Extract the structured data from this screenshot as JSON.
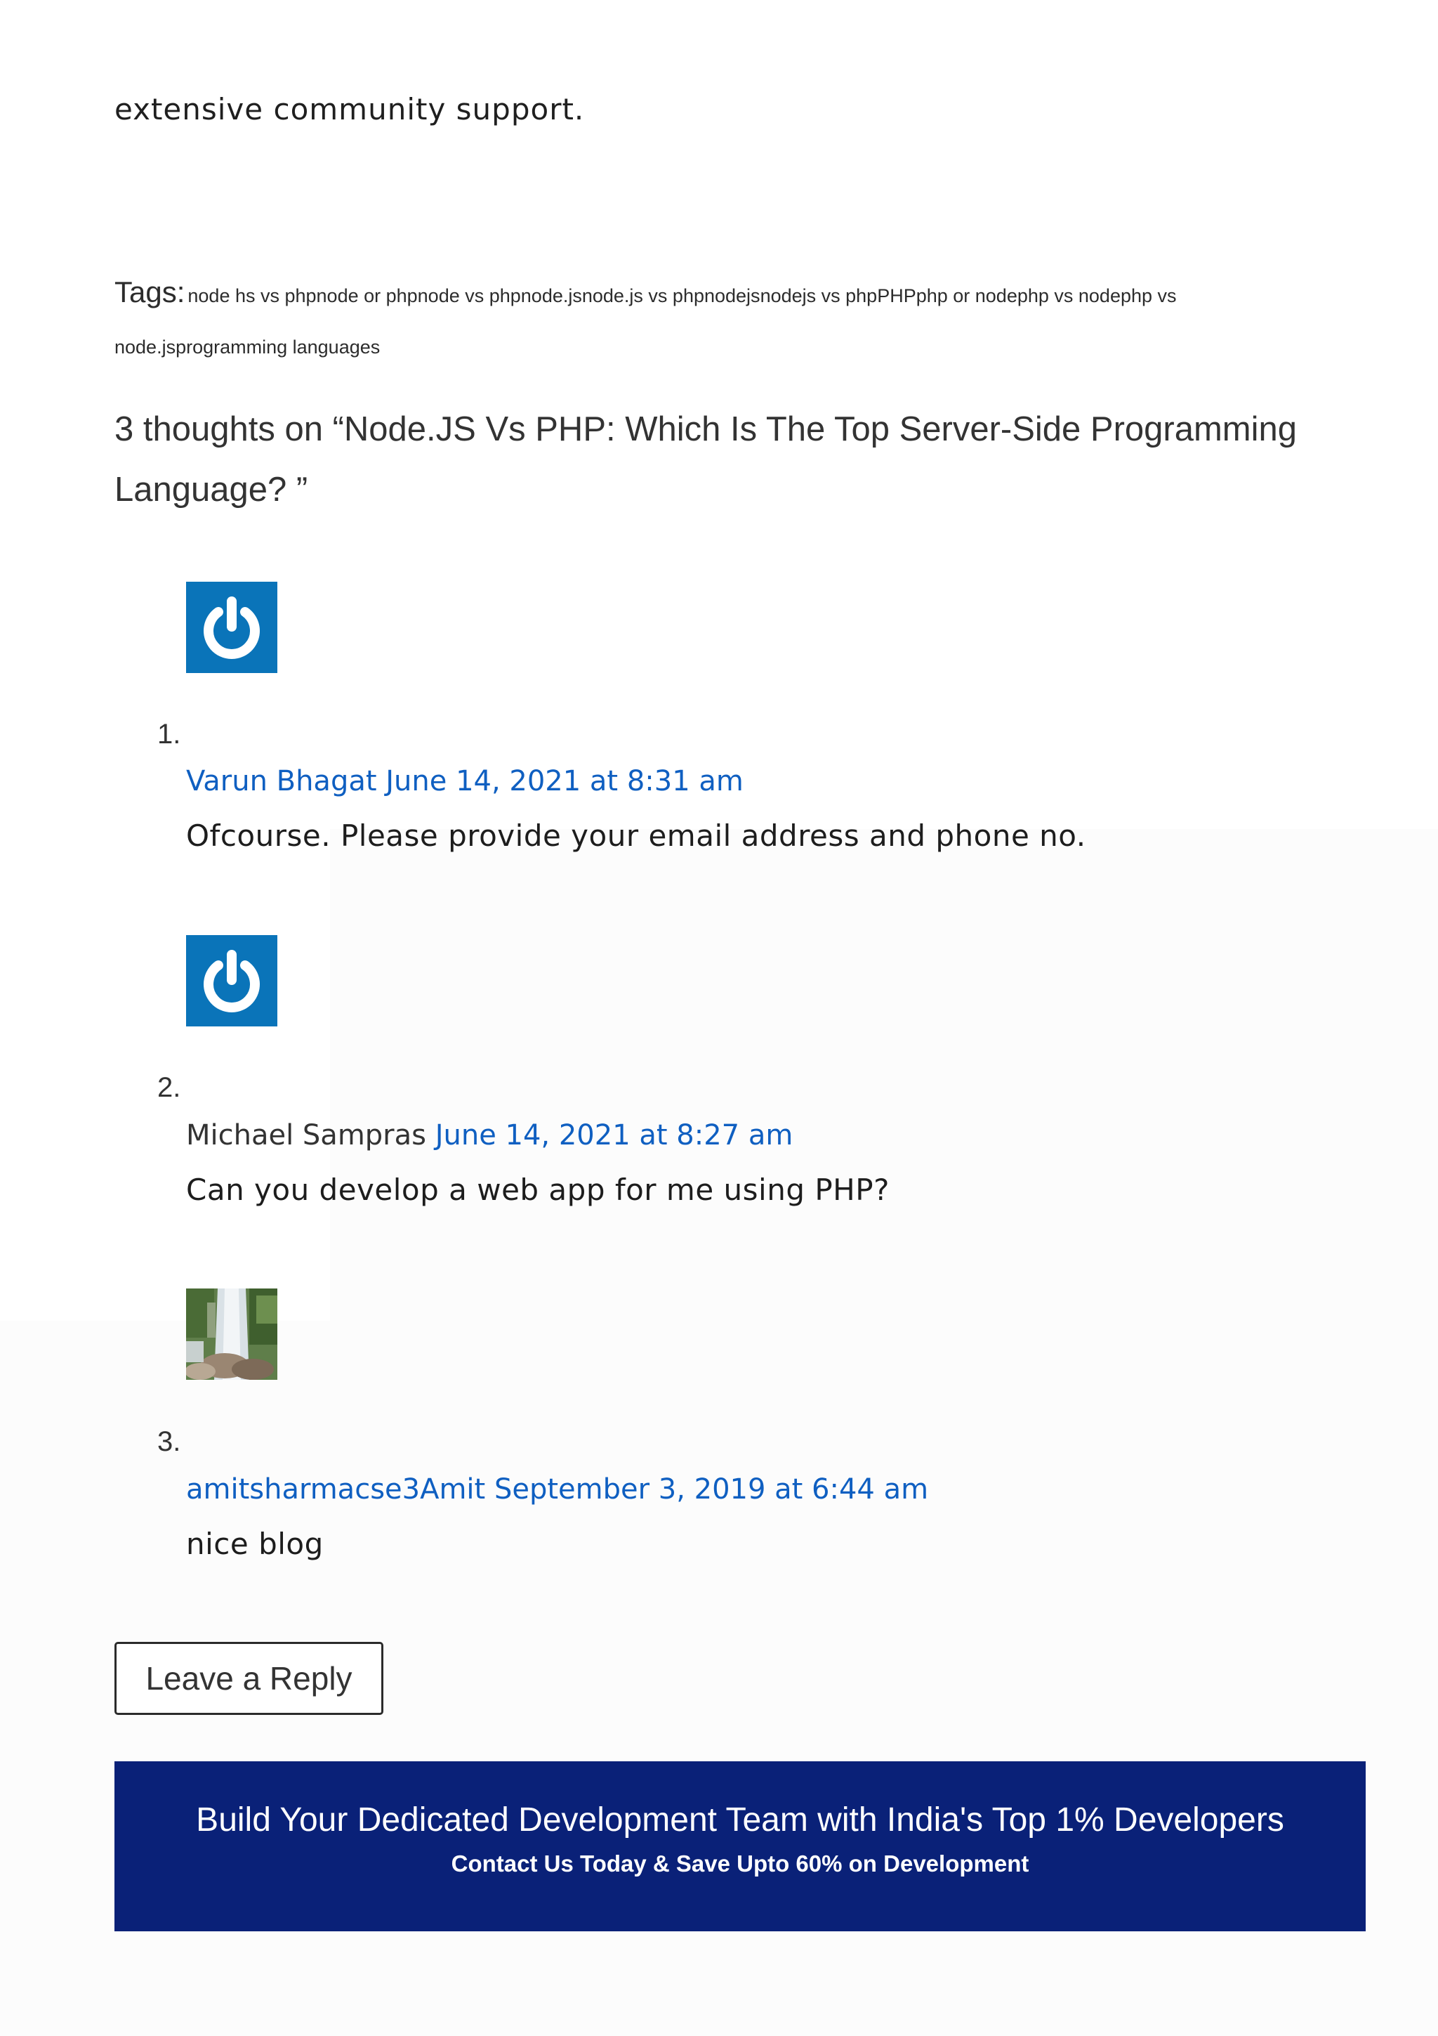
{
  "intro": {
    "text": "extensive community support."
  },
  "tags": {
    "label": "Tags:",
    "items": [
      "node hs vs php",
      "node or php",
      "node vs php",
      "node.js",
      "node.js vs php",
      "nodejs",
      "nodejs vs php",
      "PHP",
      "php or node",
      "php vs node",
      "php vs node.js",
      "programming languages"
    ]
  },
  "comments_section": {
    "title": "3 thoughts on “Node.JS Vs PHP: Which Is The Top Server-Side Programming Language? ”",
    "comments": [
      {
        "number": "1.",
        "author": "Varun Bhagat",
        "date": "June 14, 2021 at 8:31 am",
        "body": "Ofcourse. Please provide your email address and phone no.",
        "avatar_icon": "power-icon"
      },
      {
        "number": "2.",
        "author": "Michael Sampras",
        "date": "June 14, 2021 at 8:27 am",
        "body": "Can you develop a web app for me using PHP?",
        "avatar_icon": "power-icon"
      },
      {
        "number": "3.",
        "author": "amitsharmacse3Amit",
        "date": "September 3, 2019 at 6:44 am",
        "body": "nice blog",
        "avatar_icon": "waterfall-photo"
      }
    ]
  },
  "reply": {
    "label": "Leave a Reply"
  },
  "cta": {
    "heading": "Build Your Dedicated Development Team with India's Top 1% Developers",
    "subheading": "Contact Us Today & Save Upto 60% on Development",
    "background_color": "#0a2178"
  },
  "colors": {
    "link": "#0f5fc1",
    "avatar_blue": "#0a74b9",
    "text": "#1d1d1d"
  }
}
